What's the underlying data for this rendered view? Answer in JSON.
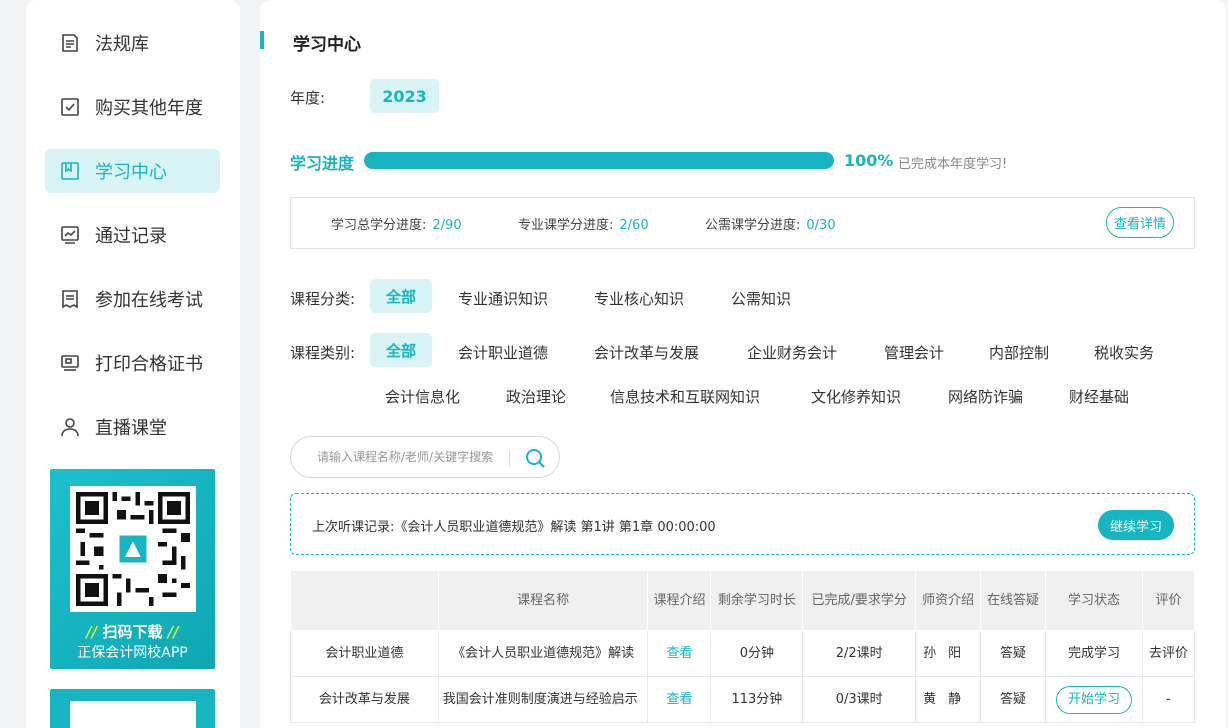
{
  "sidebar": {
    "items": [
      {
        "label": "法规库",
        "icon": "document-icon"
      },
      {
        "label": "购买其他年度",
        "icon": "checklist-icon"
      },
      {
        "label": "学习中心",
        "icon": "bookmark-icon",
        "active": true
      },
      {
        "label": "通过记录",
        "icon": "chart-monitor-icon"
      },
      {
        "label": "参加在线考试",
        "icon": "exam-icon"
      },
      {
        "label": "打印合格证书",
        "icon": "certificate-monitor-icon"
      },
      {
        "label": "直播课堂",
        "icon": "user-icon"
      }
    ],
    "promo": {
      "title": "扫码下载",
      "subtitle": "正保会计网校APP"
    }
  },
  "main": {
    "title": "学习中心",
    "year_label": "年度:",
    "year_value": "2023",
    "progress": {
      "label": "学习进度",
      "percent_value": 100,
      "percent_text": "100%",
      "note": "已完成本年度学习!"
    },
    "credits": [
      {
        "label": "学习总学分进度:",
        "value": "2/90"
      },
      {
        "label": "专业课学分进度:",
        "value": "2/60"
      },
      {
        "label": "公需课学分进度:",
        "value": "0/30"
      }
    ],
    "detail_button": "查看详情",
    "category": {
      "label": "课程分类:",
      "options": [
        "全部",
        "专业通识知识",
        "专业核心知识",
        "公需知识"
      ],
      "selected": "全部"
    },
    "type": {
      "label": "课程类别:",
      "options_row1": [
        "全部",
        "会计职业道德",
        "会计改革与发展",
        "企业财务会计",
        "管理会计",
        "内部控制",
        "税收实务"
      ],
      "options_row2": [
        "会计信息化",
        "政治理论",
        "信息技术和互联网知识",
        "文化修养知识",
        "网络防诈骗",
        "财经基础"
      ],
      "selected": "全部"
    },
    "search": {
      "placeholder": "请输入课程名称/老师/关键字搜索"
    },
    "last_record": {
      "text": "上次听课记录:《会计人员职业道德规范》解读 第1讲 第1章 00:00:00",
      "button": "继续学习"
    },
    "table": {
      "headers": [
        "",
        "课程名称",
        "课程介绍",
        "剩余学习时长",
        "已完成/要求学分",
        "师资介绍",
        "在线答疑",
        "学习状态",
        "评价"
      ],
      "rows": [
        {
          "category": "会计职业道德",
          "name": "《会计人员职业道德规范》解读",
          "intro": "查看",
          "remaining": "0分钟",
          "credits": "2/2课时",
          "teacher": "孙阳",
          "qa": "答疑",
          "status": "完成学习",
          "rating": "去评价"
        },
        {
          "category": "会计改革与发展",
          "name": "我国会计准则制度演进与经验启示",
          "intro": "查看",
          "remaining": "113分钟",
          "credits": "0/3课时",
          "teacher": "黄静",
          "qa": "答疑",
          "status": "开始学习",
          "rating": "-"
        }
      ]
    }
  },
  "colors": {
    "accent": "#16b5c1",
    "accent_light": "#d9f4f6"
  }
}
